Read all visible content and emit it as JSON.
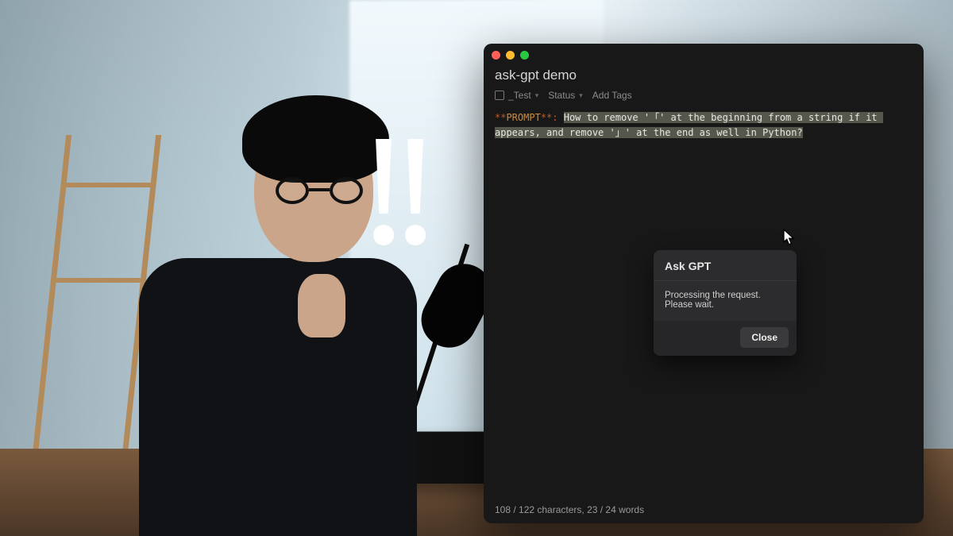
{
  "app": {
    "title": "ask-gpt demo",
    "notebook_label": "_Test",
    "status_label": "Status",
    "add_tags_label": "Add Tags",
    "prompt_marker_stars": "**",
    "prompt_marker_word": "PROMPT",
    "prompt_marker_tail": "**:",
    "prompt_text": "How to remove '「' at the beginning from a string if it appears, and remove '」' at the end as well in Python?",
    "statusbar": "108 / 122 characters, 23 / 24 words",
    "traffic": {
      "close": "close",
      "min": "minimize",
      "max": "zoom"
    }
  },
  "dialog": {
    "title": "Ask GPT",
    "body": "Processing the request. Please wait.",
    "close": "Close"
  }
}
